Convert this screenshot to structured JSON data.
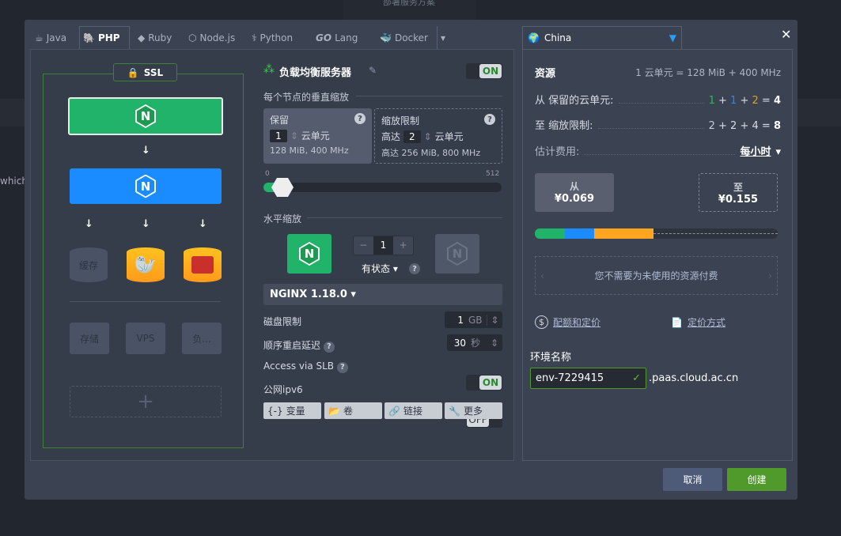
{
  "background": {
    "top_text": "部署服务方案",
    "side_text": "which"
  },
  "tabs": [
    {
      "label": "Java",
      "icon": "java-icon"
    },
    {
      "label": "PHP",
      "icon": "php-elephant-icon",
      "active": true
    },
    {
      "label": "Ruby",
      "icon": "ruby-icon"
    },
    {
      "label": "Node.js",
      "icon": "nodejs-icon"
    },
    {
      "label": "Python",
      "icon": "python-icon"
    },
    {
      "label": "Lang",
      "prefix": "GO",
      "icon": "go-icon"
    },
    {
      "label": "Docker",
      "icon": "docker-icon"
    }
  ],
  "region": {
    "label": "China"
  },
  "topology": {
    "ssl": "SSL",
    "cache": "缓存",
    "storage": "存储",
    "vps": "VPS",
    "lb": "负...",
    "add": "+"
  },
  "node": {
    "title": "负载均衡服务器",
    "toggle": "ON",
    "vertical_title": "每个节点的垂直缩放",
    "reserved": {
      "title": "保留",
      "value": "1",
      "unit": "云单元",
      "spec": "128 MiB, 400 MHz"
    },
    "limit": {
      "title": "缩放限制",
      "prefix": "高达",
      "value": "2",
      "unit": "云单元",
      "spec_prefix": "高达",
      "spec": "256 MiB, 800 MHz"
    },
    "slider": {
      "min": "0",
      "max": "512",
      "reserved": 1,
      "limit": 2
    },
    "horizontal_title": "水平缩放",
    "count": "1",
    "minus": "−",
    "plus": "+",
    "mode": "有状态",
    "version": "NGINX 1.18.0",
    "disk": {
      "label": "磁盘限制",
      "value": "1",
      "unit": "GB"
    },
    "restart": {
      "label": "顺序重启延迟",
      "value": "30",
      "unit": "秒"
    },
    "slb": {
      "label": "Access via SLB",
      "toggle": "ON"
    },
    "ipv6": {
      "label": "公网ipv6",
      "toggle": "OFF"
    },
    "actions": [
      "变量",
      "卷",
      "链接",
      "更多"
    ],
    "action_icons": [
      "{-}"
    ]
  },
  "summary": {
    "resources": "资源",
    "unit_def": "1 云单元 = 128 MiB + 400 MHz",
    "reserved_label": "从 保留的云单元:",
    "reserved_terms": [
      "1",
      "1",
      "2"
    ],
    "reserved_total": "4",
    "limit_label": "至 缩放限制:",
    "limit_terms": [
      "2",
      "2",
      "4"
    ],
    "limit_total": "8",
    "cost_label": "估计费用:",
    "period": "每小时",
    "from_label": "从",
    "from_price": "¥0.069",
    "to_label": "至",
    "to_price": "¥0.155",
    "bar": {
      "green": 1,
      "blue": 1,
      "orange": 2,
      "max": 8
    },
    "note": "您不需要为未使用的资源付费",
    "quota_link": "配额和定价",
    "pricing_link": "定价方式",
    "env_label": "环境名称",
    "env_value": "env-7229415",
    "domain": ".paas.cloud.ac.cn"
  },
  "footer": {
    "cancel": "取消",
    "create": "创建"
  },
  "colors": {
    "green": "#21b36b",
    "blue": "#1a8cff",
    "orange": "#ffa51f",
    "create": "#4f9a2a",
    "cancel": "#4d5a78"
  }
}
